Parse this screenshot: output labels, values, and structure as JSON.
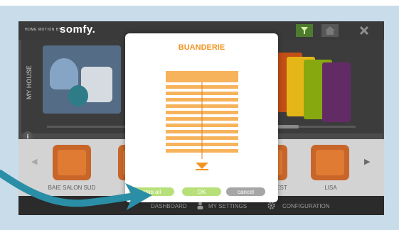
{
  "app": {
    "tagline": "home motion by",
    "brand": "somfy."
  },
  "sidebar": {
    "vertical_label": "MY HOUSE"
  },
  "devices": [
    {
      "label": "BAIE SALON SUD"
    },
    {
      "label": "EST"
    },
    {
      "label": "LISA"
    }
  ],
  "footer": {
    "items": [
      {
        "label": "DASHBOARD"
      },
      {
        "label": "MY SETTINGS"
      },
      {
        "label": "CONFIGURATION"
      }
    ]
  },
  "modal": {
    "title": "BUANDERIE",
    "stop_all_label": "stop all",
    "ok_label": "OK",
    "cancel_label": "cancel"
  },
  "colors": {
    "accent_orange": "#f29422",
    "button_green": "#b8e07a",
    "button_grey": "#a6a6a6",
    "annotation_teal": "#2a8fa6"
  },
  "icons": {
    "header_filter": "filter-icon",
    "header_home": "home-icon",
    "header_close": "close-icon",
    "info": "info-icon",
    "settings": "user-icon",
    "configuration": "gear-icon"
  }
}
